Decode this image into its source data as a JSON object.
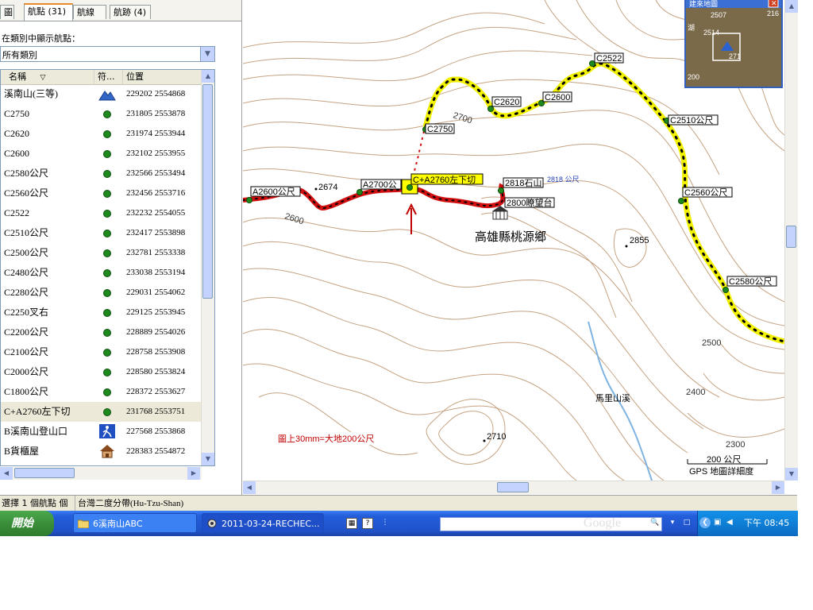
{
  "tabs": [
    {
      "label": "圖"
    },
    {
      "label": "航點 (31)"
    },
    {
      "label": "航線"
    },
    {
      "label": "航跡 (4)"
    }
  ],
  "filter": {
    "label": "在類別中顯示航點：",
    "value": "所有類別"
  },
  "list_header": {
    "name": "名稱",
    "symbol": "符...",
    "position": "位置"
  },
  "waypoints": [
    {
      "name": "溪南山(三等)",
      "symbol": "summit-icon",
      "position": "229202 2554868"
    },
    {
      "name": "C2750",
      "symbol": "green-dot-icon",
      "position": "231805 2553878"
    },
    {
      "name": "C2620",
      "symbol": "green-dot-icon",
      "position": "231974 2553944"
    },
    {
      "name": "C2600",
      "symbol": "green-dot-icon",
      "position": "232102 2553955"
    },
    {
      "name": "C2580公尺",
      "symbol": "green-dot-icon",
      "position": "232566 2553494"
    },
    {
      "name": "C2560公尺",
      "symbol": "green-dot-icon",
      "position": "232456 2553716"
    },
    {
      "name": "C2522",
      "symbol": "green-dot-icon",
      "position": "232232 2554055"
    },
    {
      "name": "C2510公尺",
      "symbol": "green-dot-icon",
      "position": "232417 2553898"
    },
    {
      "name": "C2500公尺",
      "symbol": "green-dot-icon",
      "position": "232781 2553338"
    },
    {
      "name": "C2480公尺",
      "symbol": "green-dot-icon",
      "position": "233038 2553194"
    },
    {
      "name": "C2280公尺",
      "symbol": "green-dot-icon",
      "position": "229031 2554062"
    },
    {
      "name": "C2250叉右",
      "symbol": "green-dot-icon",
      "position": "229125 2553945"
    },
    {
      "name": "C2200公尺",
      "symbol": "green-dot-icon",
      "position": "228889 2554026"
    },
    {
      "name": "C2100公尺",
      "symbol": "green-dot-icon",
      "position": "228758 2553908"
    },
    {
      "name": "C2000公尺",
      "symbol": "green-dot-icon",
      "position": "228580 2553824"
    },
    {
      "name": "C1800公尺",
      "symbol": "green-dot-icon",
      "position": "228372 2553627"
    },
    {
      "name": "C+A2760左下切",
      "symbol": "green-dot-icon",
      "position": "231768 2553751",
      "selected": true
    },
    {
      "name": "B溪南山登山口",
      "symbol": "trailhead-icon",
      "position": "227568 2553868"
    },
    {
      "name": "B貨櫃屋",
      "symbol": "house-icon",
      "position": "228383 2554872"
    }
  ],
  "map": {
    "labels": {
      "c2522": "C2522",
      "c2620": "C2620",
      "c2600": "C2600",
      "c2750": "C2750",
      "c2510": "C2510公尺",
      "c2560": "C2560公尺",
      "c2580": "C2580公尺",
      "a2600": "A2600公尺",
      "a2700": "A2700公",
      "ca2760": "C+A2760左下切",
      "s2818": "2818石山",
      "s2818_elev": "2818 公尺",
      "s2800": "2800瞭望台",
      "township": "高雄縣桃源鄉",
      "stream": "馬里山溪",
      "scale_note": "圖上30mm=大地200公尺",
      "scale_bar": "200 公尺",
      "detail": "GPS 地圖詳細度"
    },
    "spot_heights": {
      "h2674": "2674",
      "h2855": "2855",
      "h2710": "2710"
    },
    "contours": {
      "c2700": "2700",
      "c2600": "2600",
      "c2500": "2500",
      "c2400": "2400",
      "c2300": "2300"
    },
    "overview": {
      "title": "建來地圖",
      "n2507": "2507",
      "n2514": "2514",
      "n271": "271",
      "n216": "216",
      "n200": "200",
      "n_lake": "湖"
    }
  },
  "status": {
    "selection": "選擇 1 個航點 個",
    "datum": "台灣二度分帶(Hu-Tzu-Shan)"
  },
  "taskbar": {
    "start": "開始",
    "folder": "6溪南山ABC",
    "window": "2011-03-24-RECHEC...",
    "clock": "下午 08:45",
    "search_watermark": "Google"
  }
}
